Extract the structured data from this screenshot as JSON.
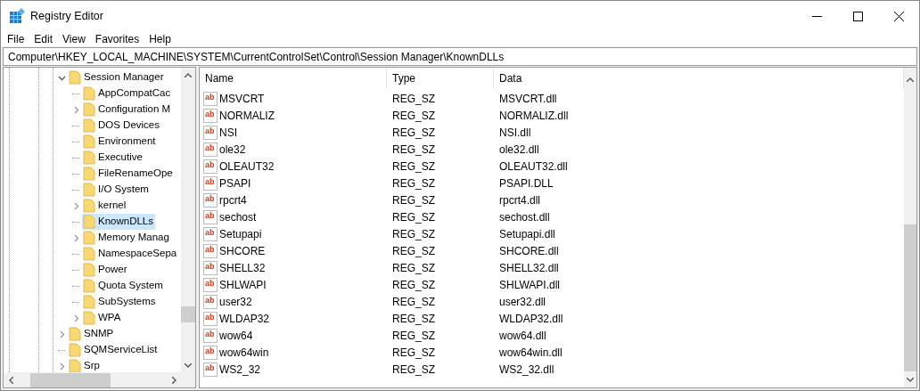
{
  "window": {
    "title": "Registry Editor"
  },
  "menu": [
    "File",
    "Edit",
    "View",
    "Favorites",
    "Help"
  ],
  "address": "Computer\\HKEY_LOCAL_MACHINE\\SYSTEM\\CurrentControlSet\\Control\\Session Manager\\KnownDLLs",
  "tree": [
    {
      "label": "Session Manager",
      "expandable": true,
      "expanded": true,
      "selected": false,
      "children": [
        {
          "label": "AppCompatCac",
          "expandable": false,
          "selected": false
        },
        {
          "label": "Configuration M",
          "expandable": true,
          "expanded": false,
          "selected": false
        },
        {
          "label": "DOS Devices",
          "expandable": false,
          "selected": false
        },
        {
          "label": "Environment",
          "expandable": false,
          "selected": false
        },
        {
          "label": "Executive",
          "expandable": false,
          "selected": false
        },
        {
          "label": "FileRenameOpe",
          "expandable": false,
          "selected": false
        },
        {
          "label": "I/O System",
          "expandable": false,
          "selected": false
        },
        {
          "label": "kernel",
          "expandable": true,
          "expanded": false,
          "selected": false
        },
        {
          "label": "KnownDLLs",
          "expandable": false,
          "selected": true
        },
        {
          "label": "Memory Manag",
          "expandable": true,
          "expanded": false,
          "selected": false
        },
        {
          "label": "NamespaceSepa",
          "expandable": false,
          "selected": false
        },
        {
          "label": "Power",
          "expandable": false,
          "selected": false
        },
        {
          "label": "Quota System",
          "expandable": false,
          "selected": false
        },
        {
          "label": "SubSystems",
          "expandable": false,
          "selected": false
        },
        {
          "label": "WPA",
          "expandable": true,
          "expanded": false,
          "selected": false
        }
      ]
    },
    {
      "label": "SNMP",
      "expandable": true,
      "expanded": false,
      "selected": false
    },
    {
      "label": "SQMServiceList",
      "expandable": false,
      "selected": false
    },
    {
      "label": "Srp",
      "expandable": true,
      "expanded": false,
      "selected": false
    }
  ],
  "table": {
    "columns": [
      "Name",
      "Type",
      "Data"
    ],
    "rows": [
      {
        "icon": "ab",
        "name": "MSVCRT",
        "type": "REG_SZ",
        "data": "MSVCRT.dll"
      },
      {
        "icon": "ab",
        "name": "NORMALIZ",
        "type": "REG_SZ",
        "data": "NORMALIZ.dll"
      },
      {
        "icon": "ab",
        "name": "NSI",
        "type": "REG_SZ",
        "data": "NSI.dll"
      },
      {
        "icon": "ab",
        "name": "ole32",
        "type": "REG_SZ",
        "data": "ole32.dll"
      },
      {
        "icon": "ab",
        "name": "OLEAUT32",
        "type": "REG_SZ",
        "data": "OLEAUT32.dll"
      },
      {
        "icon": "ab",
        "name": "PSAPI",
        "type": "REG_SZ",
        "data": "PSAPI.DLL"
      },
      {
        "icon": "ab",
        "name": "rpcrt4",
        "type": "REG_SZ",
        "data": "rpcrt4.dll"
      },
      {
        "icon": "ab",
        "name": "sechost",
        "type": "REG_SZ",
        "data": "sechost.dll"
      },
      {
        "icon": "ab",
        "name": "Setupapi",
        "type": "REG_SZ",
        "data": "Setupapi.dll"
      },
      {
        "icon": "ab",
        "name": "SHCORE",
        "type": "REG_SZ",
        "data": "SHCORE.dll"
      },
      {
        "icon": "ab",
        "name": "SHELL32",
        "type": "REG_SZ",
        "data": "SHELL32.dll"
      },
      {
        "icon": "ab",
        "name": "SHLWAPI",
        "type": "REG_SZ",
        "data": "SHLWAPI.dll"
      },
      {
        "icon": "ab",
        "name": "user32",
        "type": "REG_SZ",
        "data": "user32.dll"
      },
      {
        "icon": "ab",
        "name": "WLDAP32",
        "type": "REG_SZ",
        "data": "WLDAP32.dll"
      },
      {
        "icon": "ab",
        "name": "wow64",
        "type": "REG_SZ",
        "data": "wow64.dll"
      },
      {
        "icon": "ab",
        "name": "wow64win",
        "type": "REG_SZ",
        "data": "wow64win.dll"
      },
      {
        "icon": "ab",
        "name": "WS2_32",
        "type": "REG_SZ",
        "data": "WS2_32.dll"
      }
    ]
  }
}
